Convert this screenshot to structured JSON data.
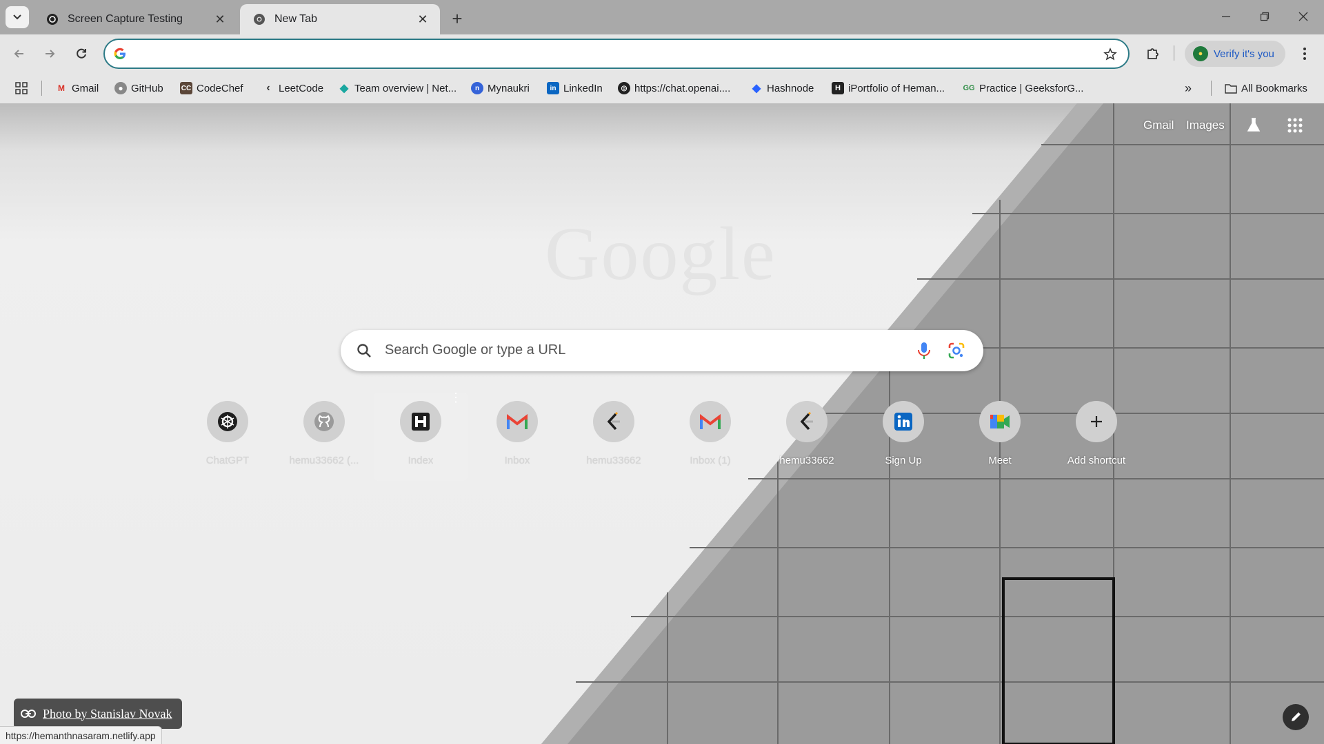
{
  "tabs": [
    {
      "title": "Screen Capture Testing",
      "icon": "chatgpt-icon"
    },
    {
      "title": "New Tab",
      "icon": "chrome-icon"
    }
  ],
  "omnibox": {
    "value": "",
    "placeholder": ""
  },
  "profile": {
    "verify_label": "Verify it's you"
  },
  "bookmarks": {
    "items": [
      {
        "label": "Gmail"
      },
      {
        "label": "GitHub"
      },
      {
        "label": "CodeChef"
      },
      {
        "label": "LeetCode"
      },
      {
        "label": "Team overview | Net..."
      },
      {
        "label": "Mynaukri"
      },
      {
        "label": "LinkedIn"
      },
      {
        "label": "https://chat.openai...."
      },
      {
        "label": "Hashnode"
      },
      {
        "label": "iPortfolio of Heman..."
      },
      {
        "label": "Practice | GeeksforG..."
      }
    ],
    "all_label": "All Bookmarks"
  },
  "ntp": {
    "gmail_link": "Gmail",
    "images_link": "Images",
    "search_placeholder": "Search Google or type a URL",
    "shortcuts": [
      {
        "label": "ChatGPT",
        "icon": "chatgpt-icon"
      },
      {
        "label": "hemu33662 (...",
        "icon": "github-icon"
      },
      {
        "label": "Index",
        "icon": "hashnode-h-icon"
      },
      {
        "label": "Inbox",
        "icon": "gmail-icon"
      },
      {
        "label": "hemu33662",
        "icon": "leetcode-icon"
      },
      {
        "label": "Inbox (1)",
        "icon": "gmail-icon"
      },
      {
        "label": "hemu33662",
        "icon": "leetcode-icon"
      },
      {
        "label": "Sign Up",
        "icon": "linkedin-icon"
      },
      {
        "label": "Meet",
        "icon": "meet-icon"
      },
      {
        "label": "Add shortcut",
        "icon": "plus-icon"
      }
    ],
    "photo_credit": "Photo by Stanislav Novak",
    "status_url": "https://hemanthnasaram.netlify.app"
  }
}
